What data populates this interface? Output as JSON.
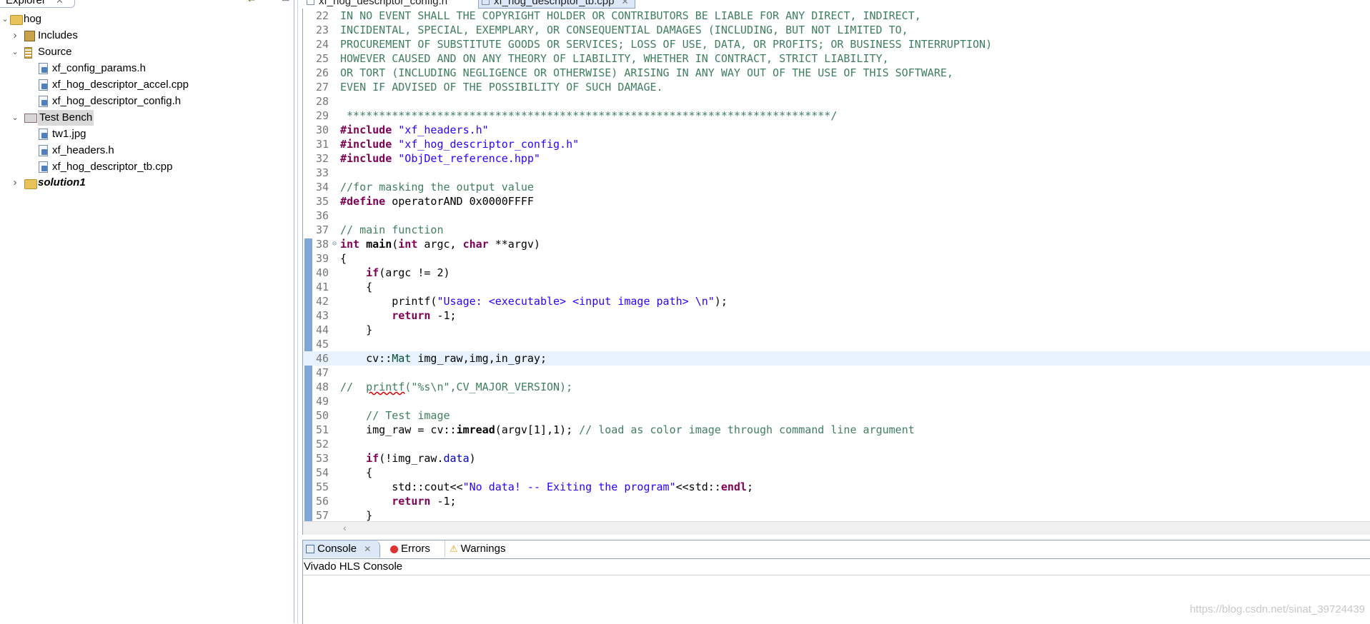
{
  "explorer": {
    "tab_label": "Explorer",
    "tree": [
      {
        "label": "hog",
        "twisty": "expanded",
        "icon": "project-icon"
      },
      {
        "label": "Includes",
        "twisty": "collapsed",
        "icon": "includes-icon"
      },
      {
        "label": "Source",
        "twisty": "expanded",
        "icon": "source-folder-icon"
      },
      {
        "label": "xf_config_params.h",
        "icon": "header-file-icon"
      },
      {
        "label": "xf_hog_descriptor_accel.cpp",
        "icon": "cpp-file-icon"
      },
      {
        "label": "xf_hog_descriptor_config.h",
        "icon": "header-file-icon"
      },
      {
        "label": "Test Bench",
        "twisty": "expanded",
        "icon": "testbench-folder-icon",
        "selected": true
      },
      {
        "label": "tw1.jpg",
        "icon": "image-file-icon"
      },
      {
        "label": "xf_headers.h",
        "icon": "header-file-icon"
      },
      {
        "label": "xf_hog_descriptor_tb.cpp",
        "icon": "cpp-file-icon"
      },
      {
        "label": "solution1",
        "twisty": "collapsed",
        "icon": "solution-folder-icon"
      }
    ]
  },
  "editor": {
    "tabs": [
      {
        "label": "xf_hog_descriptor_config.h",
        "active": false
      },
      {
        "label": "xf_hog_descriptor_tb.cpp",
        "active": true
      }
    ],
    "lines": [
      {
        "n": "22",
        "src": "IN NO EVENT SHALL THE COPYRIGHT HOLDER OR CONTRIBUTORS BE LIABLE FOR ANY DIRECT, INDIRECT,"
      },
      {
        "n": "23",
        "src": "INCIDENTAL, SPECIAL, EXEMPLARY, OR CONSEQUENTIAL DAMAGES (INCLUDING, BUT NOT LIMITED TO,"
      },
      {
        "n": "24",
        "src": "PROCUREMENT OF SUBSTITUTE GOODS OR SERVICES; LOSS OF USE, DATA, OR PROFITS; OR BUSINESS INTERRUPTION)"
      },
      {
        "n": "25",
        "src": "HOWEVER CAUSED AND ON ANY THEORY OF LIABILITY, WHETHER IN CONTRACT, STRICT LIABILITY,"
      },
      {
        "n": "26",
        "src": "OR TORT (INCLUDING NEGLIGENCE OR OTHERWISE) ARISING IN ANY WAY OUT OF THE USE OF THIS SOFTWARE,"
      },
      {
        "n": "27",
        "src": "EVEN IF ADVISED OF THE POSSIBILITY OF SUCH DAMAGE."
      },
      {
        "n": "28",
        "src": ""
      },
      {
        "n": "29",
        "src": " ***************************************************************************/"
      },
      {
        "n": "30",
        "src": "#include \"xf_headers.h\""
      },
      {
        "n": "31",
        "src": "#include \"xf_hog_descriptor_config.h\""
      },
      {
        "n": "32",
        "src": "#include \"ObjDet_reference.hpp\""
      },
      {
        "n": "33",
        "src": ""
      },
      {
        "n": "34",
        "src": "//for masking the output value"
      },
      {
        "n": "35",
        "src": "#define operatorAND 0x0000FFFF"
      },
      {
        "n": "36",
        "src": ""
      },
      {
        "n": "37",
        "src": "// main function"
      },
      {
        "n": "38",
        "src": "int main(int argc, char **argv)"
      },
      {
        "n": "39",
        "src": "{"
      },
      {
        "n": "40",
        "src": "    if(argc != 2)"
      },
      {
        "n": "41",
        "src": "    {"
      },
      {
        "n": "42",
        "src": "        printf(\"Usage: <executable> <input image path> \\n\");"
      },
      {
        "n": "43",
        "src": "        return -1;"
      },
      {
        "n": "44",
        "src": "    }"
      },
      {
        "n": "45",
        "src": ""
      },
      {
        "n": "46",
        "src": "    cv::Mat img_raw,img,in_gray;"
      },
      {
        "n": "47",
        "src": ""
      },
      {
        "n": "48",
        "src": "//  printf(\"%s\\n\",CV_MAJOR_VERSION);"
      },
      {
        "n": "49",
        "src": ""
      },
      {
        "n": "50",
        "src": "    // Test image"
      },
      {
        "n": "51",
        "src": "    img_raw = cv::imread(argv[1],1); // load as color image through command line argument"
      },
      {
        "n": "52",
        "src": ""
      },
      {
        "n": "53",
        "src": "    if(!img_raw.data)"
      },
      {
        "n": "54",
        "src": "    {"
      },
      {
        "n": "55",
        "src": "        std::cout<<\"No data! -- Exiting the program\"<<std::endl;"
      },
      {
        "n": "56",
        "src": "        return -1;"
      },
      {
        "n": "57",
        "src": "    }"
      }
    ],
    "current_line": "46",
    "fold_line": "38"
  },
  "console": {
    "tabs": [
      {
        "label": "Console",
        "icon": "console-icon",
        "active": true
      },
      {
        "label": "Errors",
        "icon": "errors-icon",
        "active": false
      },
      {
        "label": "Warnings",
        "icon": "warnings-icon",
        "active": false
      }
    ],
    "title": "Vivado HLS Console"
  },
  "watermark": "https://blog.csdn.net/sinat_39724439",
  "colors": {
    "keyword": "#7f0055",
    "comment": "#3f7f5f",
    "string": "#2a00ff",
    "current_line_bg": "#e8f2fe",
    "tab_active_bg": "#dce8f7"
  }
}
